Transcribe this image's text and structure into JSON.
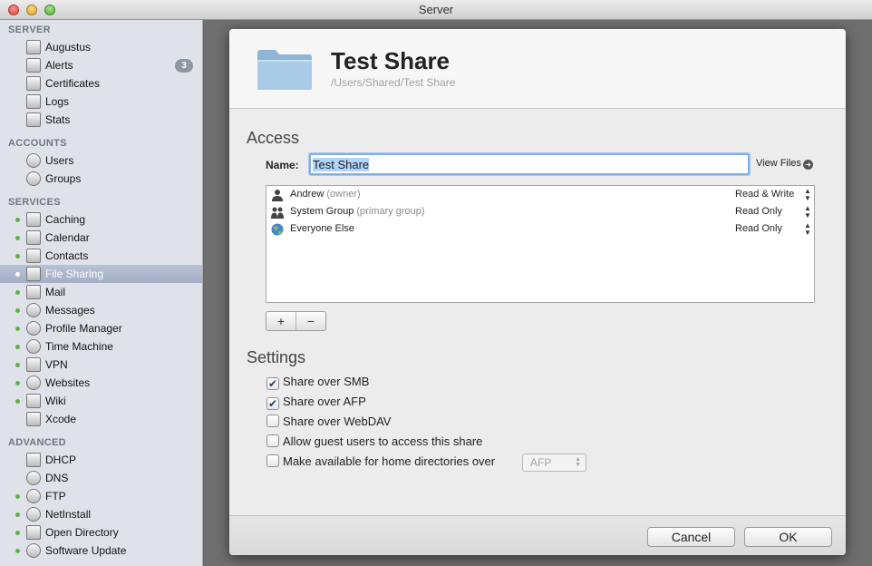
{
  "window": {
    "title": "Server"
  },
  "sidebar": {
    "sections": [
      {
        "label": "SERVER"
      },
      {
        "label": "ACCOUNTS"
      },
      {
        "label": "SERVICES"
      },
      {
        "label": "ADVANCED"
      }
    ],
    "server_items": [
      {
        "label": "Augustus",
        "icon": "computer-icon"
      },
      {
        "label": "Alerts",
        "icon": "megaphone-icon",
        "badge": "3"
      },
      {
        "label": "Certificates",
        "icon": "certificate-icon"
      },
      {
        "label": "Logs",
        "icon": "log-icon"
      },
      {
        "label": "Stats",
        "icon": "stats-icon"
      }
    ],
    "account_items": [
      {
        "label": "Users",
        "icon": "user-icon"
      },
      {
        "label": "Groups",
        "icon": "group-icon"
      }
    ],
    "service_items": [
      {
        "label": "Caching"
      },
      {
        "label": "Calendar"
      },
      {
        "label": "Contacts"
      },
      {
        "label": "File Sharing",
        "selected": true
      },
      {
        "label": "Mail"
      },
      {
        "label": "Messages"
      },
      {
        "label": "Profile Manager"
      },
      {
        "label": "Time Machine"
      },
      {
        "label": "VPN"
      },
      {
        "label": "Websites"
      },
      {
        "label": "Wiki"
      },
      {
        "label": "Xcode"
      }
    ],
    "advanced_items": [
      {
        "label": "DHCP"
      },
      {
        "label": "DNS"
      },
      {
        "label": "FTP"
      },
      {
        "label": "NetInstall"
      },
      {
        "label": "Open Directory"
      },
      {
        "label": "Software Update"
      }
    ]
  },
  "sheet": {
    "title": "Test Share",
    "path": "/Users/Shared/Test Share",
    "access_heading": "Access",
    "name_label": "Name:",
    "name_value": "Test Share",
    "view_files": "View Files",
    "permissions": [
      {
        "name": "Andrew",
        "note": "(owner)",
        "access": "Read & Write",
        "icon": "user-icon"
      },
      {
        "name": "System Group",
        "note": "(primary group)",
        "access": "Read Only",
        "icon": "group-icon"
      },
      {
        "name": "Everyone Else",
        "note": "",
        "access": "Read Only",
        "icon": "globe-icon"
      }
    ],
    "add_label": "+",
    "remove_label": "−",
    "settings_heading": "Settings",
    "settings": [
      {
        "label": "Share over SMB",
        "checked": true
      },
      {
        "label": "Share over AFP",
        "checked": true
      },
      {
        "label": "Share over WebDAV",
        "checked": false
      },
      {
        "label": "Allow guest users to access this share",
        "checked": false
      },
      {
        "label": "Make available for home directories over",
        "checked": false
      }
    ],
    "home_dir_protocol": "AFP",
    "cancel_label": "Cancel",
    "ok_label": "OK"
  }
}
